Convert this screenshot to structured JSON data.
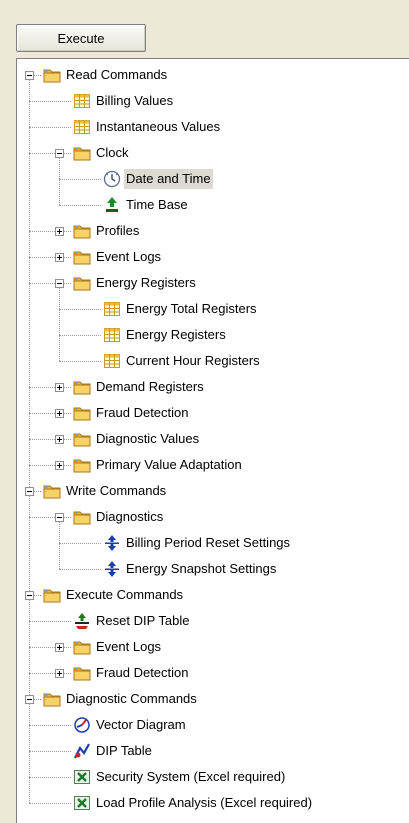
{
  "toolbar": {
    "execute_label": "Execute"
  },
  "tree": [
    {
      "label": "Read Commands",
      "depth": 0,
      "type": "folder",
      "expander": "minus"
    },
    {
      "label": "Billing Values",
      "depth": 1,
      "type": "grid"
    },
    {
      "label": "Instantaneous Values",
      "depth": 1,
      "type": "grid"
    },
    {
      "label": "Clock",
      "depth": 1,
      "type": "folder",
      "expander": "minus"
    },
    {
      "label": "Date and Time",
      "depth": 2,
      "type": "clock",
      "selected": true
    },
    {
      "label": "Time Base",
      "depth": 2,
      "type": "timebase"
    },
    {
      "label": "Profiles",
      "depth": 1,
      "type": "folder",
      "expander": "plus"
    },
    {
      "label": "Event Logs",
      "depth": 1,
      "type": "folder",
      "expander": "plus"
    },
    {
      "label": "Energy Registers",
      "depth": 1,
      "type": "folder",
      "expander": "minus"
    },
    {
      "label": "Energy Total Registers",
      "depth": 2,
      "type": "grid"
    },
    {
      "label": "Energy Registers",
      "depth": 2,
      "type": "grid"
    },
    {
      "label": "Current Hour Registers",
      "depth": 2,
      "type": "grid"
    },
    {
      "label": "Demand Registers",
      "depth": 1,
      "type": "folder",
      "expander": "plus"
    },
    {
      "label": "Fraud Detection",
      "depth": 1,
      "type": "folder",
      "expander": "plus"
    },
    {
      "label": "Diagnostic Values",
      "depth": 1,
      "type": "folder",
      "expander": "plus"
    },
    {
      "label": "Primary Value Adaptation",
      "depth": 1,
      "type": "folder",
      "expander": "plus"
    },
    {
      "label": "Write Commands",
      "depth": 0,
      "type": "folder",
      "expander": "minus"
    },
    {
      "label": "Diagnostics",
      "depth": 1,
      "type": "folder",
      "expander": "minus"
    },
    {
      "label": "Billing Period Reset Settings",
      "depth": 2,
      "type": "writearrow"
    },
    {
      "label": "Energy Snapshot Settings",
      "depth": 2,
      "type": "writearrow"
    },
    {
      "label": "Execute Commands",
      "depth": 0,
      "type": "folder",
      "expander": "minus"
    },
    {
      "label": "Reset DIP Table",
      "depth": 1,
      "type": "reset"
    },
    {
      "label": "Event Logs",
      "depth": 1,
      "type": "folder",
      "expander": "plus"
    },
    {
      "label": "Fraud Detection",
      "depth": 1,
      "type": "folder",
      "expander": "plus"
    },
    {
      "label": "Diagnostic Commands",
      "depth": 0,
      "type": "folder",
      "expander": "minus"
    },
    {
      "label": "Vector Diagram",
      "depth": 1,
      "type": "vector"
    },
    {
      "label": "DIP Table",
      "depth": 1,
      "type": "dip"
    },
    {
      "label": "Security System (Excel required)",
      "depth": 1,
      "type": "excel"
    },
    {
      "label": "Load Profile Analysis (Excel required)",
      "depth": 1,
      "type": "excel"
    }
  ],
  "icons": {
    "folder": "folder-icon",
    "grid": "table-grid-icon",
    "clock": "clock-icon",
    "timebase": "time-base-icon",
    "writearrow": "write-arrow-icon",
    "reset": "reset-icon",
    "vector": "vector-diagram-icon",
    "dip": "dip-table-icon",
    "excel": "excel-icon"
  },
  "colors": {
    "selection": "#dcdad2",
    "background": "#ece9d8",
    "tree_bg": "#ffffff"
  }
}
